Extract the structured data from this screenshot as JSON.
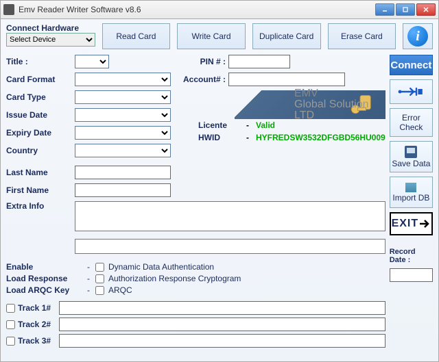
{
  "window": {
    "title": "Emv Reader Writer Software v8.6"
  },
  "connectHardware": {
    "label": "Connect Hardware",
    "selected": "Select Device"
  },
  "actions": {
    "read": "Read Card",
    "write": "Write Card",
    "duplicate": "Duplicate Card",
    "erase": "Erase Card"
  },
  "labels": {
    "title": "Title :",
    "cardFormat": "Card Format",
    "cardType": "Card Type",
    "issueDate": "Issue Date",
    "expiryDate": "Expiry Date",
    "country": "Country",
    "lastName": "Last Name",
    "firstName": "First Name",
    "extraInfo": "Extra Info",
    "pin": "PIN # :",
    "account": "Account# :",
    "enable": "Enable",
    "loadResponse": "Load Response",
    "loadArqc": "Load ARQC Key",
    "dynAuth": "Dynamic Data Authentication",
    "authResp": "Authorization Response Cryptogram",
    "arqc": "ARQC",
    "track1": "Track 1#",
    "track2": "Track 2#",
    "track3": "Track 3#",
    "recordDate": "Record Date :"
  },
  "banner": {
    "line1": "EMV",
    "line2": "Global Solution LTD"
  },
  "license": {
    "label": "Licente",
    "value": "Valid",
    "hwidLabel": "HWID",
    "hwid": "HYFREDSW3532DFGBD56HU009"
  },
  "side": {
    "connect": "Connect",
    "errorCheck": "Error Check",
    "saveData": "Save Data",
    "importDb": "Import DB",
    "exit": "EXIT"
  },
  "values": {
    "title": "",
    "cardFormat": "",
    "cardType": "",
    "issueDate": "",
    "expiryDate": "",
    "country": "",
    "lastName": "",
    "firstName": "",
    "pin": "",
    "account": "",
    "extraInfo": "",
    "extraLine": "",
    "track1": "",
    "track2": "",
    "track3": "",
    "recordDate": ""
  }
}
